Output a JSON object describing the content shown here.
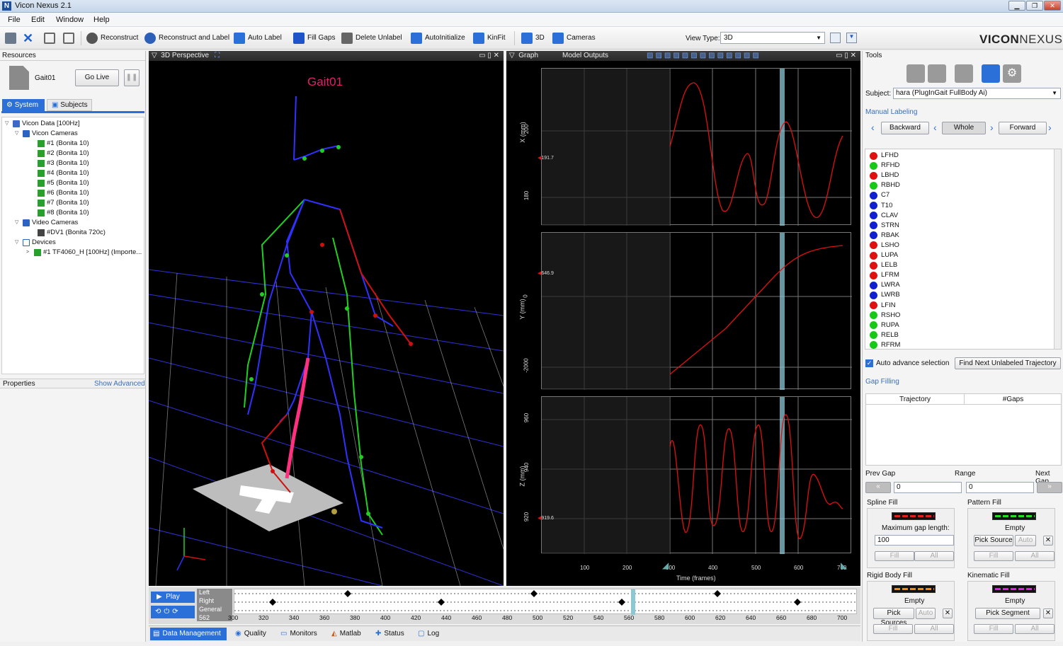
{
  "window": {
    "title": "Vicon Nexus 2.1",
    "min": "▁",
    "max": "❐",
    "close": "✕"
  },
  "menu": [
    "File",
    "Edit",
    "Window",
    "Help"
  ],
  "toolbar": {
    "reconstruct": "Reconstruct",
    "reconstruct_label": "Reconstruct and Label",
    "auto_label": "Auto Label",
    "fill_gaps": "Fill Gaps",
    "delete_unlabel": "Delete Unlabel",
    "autoinitialize": "AutoInitialize",
    "kinfit": "KinFit",
    "view3d": "3D",
    "cameras": "Cameras",
    "view_type_label": "View Type:",
    "view_type_value": "3D",
    "logo_a": "VICON",
    "logo_b": "NEXUS"
  },
  "resources": {
    "header": "Resources",
    "trial": "Gait01",
    "go_live": "Go Live",
    "tabs": [
      "System",
      "Subjects"
    ],
    "tree": {
      "root": "Vicon Data [100Hz]",
      "vicon_cameras": "Vicon Cameras",
      "cameras": [
        "#1 (Bonita 10)",
        "#2 (Bonita 10)",
        "#3 (Bonita 10)",
        "#4 (Bonita 10)",
        "#5 (Bonita 10)",
        "#6 (Bonita 10)",
        "#7 (Bonita 10)",
        "#8 (Bonita 10)"
      ],
      "video_cameras": "Video Cameras",
      "video": "#DV1 (Bonita 720c)",
      "devices": "Devices",
      "device": "#1 TF4060_H [100Hz] (Importe..."
    },
    "properties": "Properties",
    "show_advanced": "Show Advanced"
  },
  "view3d": {
    "header": "3D Perspective",
    "subject_label": "Gait01"
  },
  "graph": {
    "header": "Graph",
    "mode": "Model Outputs",
    "plots": [
      {
        "ylabel": "X (mm)",
        "ticks": [
          "200",
          "180"
        ],
        "cursor": "191.7"
      },
      {
        "ylabel": "Y (mm)",
        "ticks": [
          "0",
          "-2000"
        ],
        "cursor": "646.9"
      },
      {
        "ylabel": "Z (mm)",
        "ticks": [
          "960",
          "940",
          "920"
        ],
        "cursor": "919.6"
      }
    ],
    "xticks": [
      "100",
      "200",
      "300",
      "400",
      "500",
      "600",
      "700"
    ],
    "xlabel": "Time (frames)"
  },
  "timeline": {
    "play": "Play",
    "rows": [
      "Left",
      "Right",
      "General"
    ],
    "frame": "562",
    "ticks": [
      "300",
      "320",
      "340",
      "360",
      "380",
      "400",
      "420",
      "440",
      "460",
      "480",
      "500",
      "520",
      "540",
      "560",
      "580",
      "600",
      "620",
      "640",
      "660",
      "680",
      "700"
    ]
  },
  "bottom_tabs": [
    "Data Management",
    "Quality",
    "Monitors",
    "Matlab",
    "Status",
    "Log"
  ],
  "tools": {
    "header": "Tools",
    "subject_label": "Subject:",
    "subject_value": "hara (PlugInGait FullBody Ai)",
    "manual_labeling": "Manual Labeling",
    "backward": "Backward",
    "whole": "Whole",
    "forward": "Forward",
    "markers": [
      {
        "name": "LFHD",
        "color": "#e01010"
      },
      {
        "name": "RFHD",
        "color": "#18c818"
      },
      {
        "name": "LBHD",
        "color": "#e01010"
      },
      {
        "name": "RBHD",
        "color": "#18c818"
      },
      {
        "name": "C7",
        "color": "#1020d0"
      },
      {
        "name": "T10",
        "color": "#1020d0"
      },
      {
        "name": "CLAV",
        "color": "#1020d0"
      },
      {
        "name": "STRN",
        "color": "#1020d0"
      },
      {
        "name": "RBAK",
        "color": "#1020d0"
      },
      {
        "name": "LSHO",
        "color": "#e01010"
      },
      {
        "name": "LUPA",
        "color": "#e01010"
      },
      {
        "name": "LELB",
        "color": "#e01010"
      },
      {
        "name": "LFRM",
        "color": "#e01010"
      },
      {
        "name": "LWRA",
        "color": "#1020d0"
      },
      {
        "name": "LWRB",
        "color": "#1020d0"
      },
      {
        "name": "LFIN",
        "color": "#e01010"
      },
      {
        "name": "RSHO",
        "color": "#18c818"
      },
      {
        "name": "RUPA",
        "color": "#18c818"
      },
      {
        "name": "RELB",
        "color": "#18c818"
      },
      {
        "name": "RFRM",
        "color": "#18c818"
      }
    ],
    "auto_advance": "Auto advance selection",
    "find_next": "Find Next Unlabeled Trajectory",
    "gap_filling": "Gap Filling",
    "col_trajectory": "Trajectory",
    "col_gaps": "#Gaps",
    "prev_gap": "Prev Gap",
    "range": "Range",
    "next_gap": "Next Gap",
    "range_from": "0",
    "range_to": "0",
    "spline_fill": "Spline Fill",
    "pattern_fill": "Pattern Fill",
    "max_gap": "Maximum gap length:",
    "max_gap_value": "100",
    "empty": "Empty",
    "pick_source": "Pick Source",
    "auto": "Auto",
    "fill": "Fill",
    "all": "All",
    "rigid_body_fill": "Rigid Body Fill",
    "kinematic_fill": "Kinematic Fill",
    "pick_sources": "Pick Sources",
    "pick_segment": "Pick Segment"
  }
}
